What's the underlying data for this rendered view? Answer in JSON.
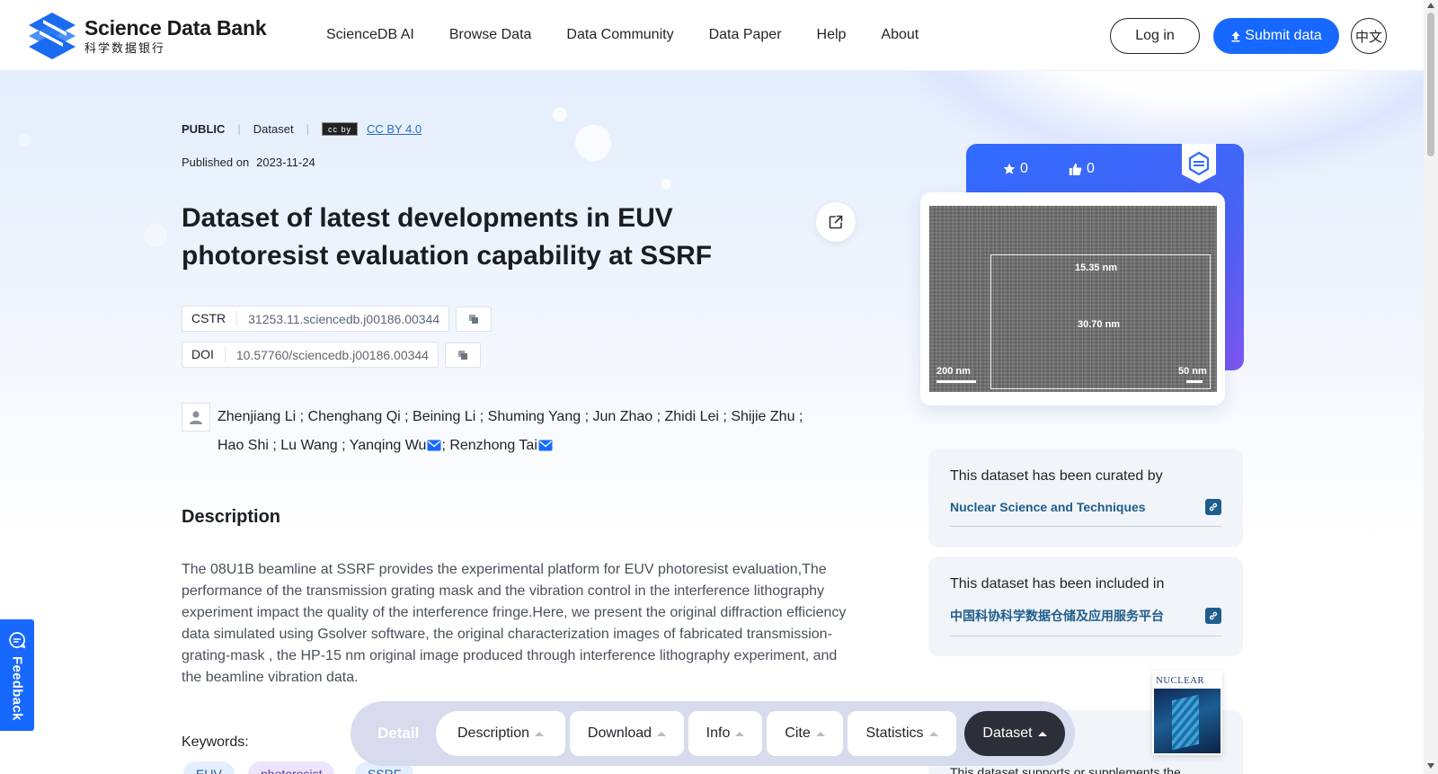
{
  "header": {
    "logo_en": "Science Data Bank",
    "logo_cn": "科学数据银行",
    "nav": [
      "ScienceDB AI",
      "Browse Data",
      "Data Community",
      "Data Paper",
      "Help",
      "About"
    ],
    "login": "Log in",
    "submit": "Submit data",
    "lang": "中文"
  },
  "dataset": {
    "visibility": "PUBLIC",
    "type": "Dataset",
    "cc_badge": "cc by",
    "license": "CC BY 4.0",
    "published_label": "Published on",
    "published_date": "2023-11-24",
    "title": "Dataset of latest developments in EUV photoresist evaluation capability at SSRF",
    "cstr_label": "CSTR",
    "cstr": "31253.11.sciencedb.j00186.00344",
    "doi_label": "DOI",
    "doi": "10.57760/sciencedb.j00186.00344",
    "authors_line1": "Zhenjiang Li ; Chenghang Qi ; Beining Li ; Shuming Yang ; Jun Zhao ; Zhidi Lei ; Shijie Zhu ;",
    "authors_line2a": "Hao Shi ; Lu Wang ; Yanqing Wu",
    "authors_line2b": "; Renzhong Tai"
  },
  "description": {
    "title": "Description",
    "text": "The 08U1B beamline at SSRF provides the experimental platform for EUV photoresist evaluation,The performance of the transmission grating mask and the vibration control in the interference lithography experiment impact the quality of the interference fringe.Here, we present the original diffraction efficiency data simulated using Gsolver software, the original characterization images of fabricated transmission-grating-mask , the HP-15 nm original image produced through interference lithography experiment, and the beamline vibration data.",
    "keywords_label": "Keywords:",
    "keywords": [
      "EUV",
      "photoresist",
      "SSRF"
    ]
  },
  "stats": {
    "stars": "0",
    "likes": "0"
  },
  "image": {
    "label_a": "15.35 nm",
    "label_b": "30.70 nm",
    "scale_left": "200 nm",
    "scale_right": "50 nm"
  },
  "curated": {
    "title": "This dataset has been curated by",
    "link": "Nuclear Science and Techniques"
  },
  "included": {
    "title": "This dataset has been included in",
    "link": "中国科协科学数据仓储及应用服务平台"
  },
  "journal": {
    "text": "This dataset supports or supplements the",
    "cover_title": "NUCLEAR"
  },
  "feedback": "Feedback",
  "tabbar": {
    "detail": "Detail",
    "tabs": [
      "Description",
      "Download",
      "Info",
      "Cite",
      "Statistics",
      "Dataset"
    ]
  },
  "colors": {
    "accent": "#1668ff",
    "link": "#1e5d8c",
    "dark_tab": "#2c2f38"
  }
}
